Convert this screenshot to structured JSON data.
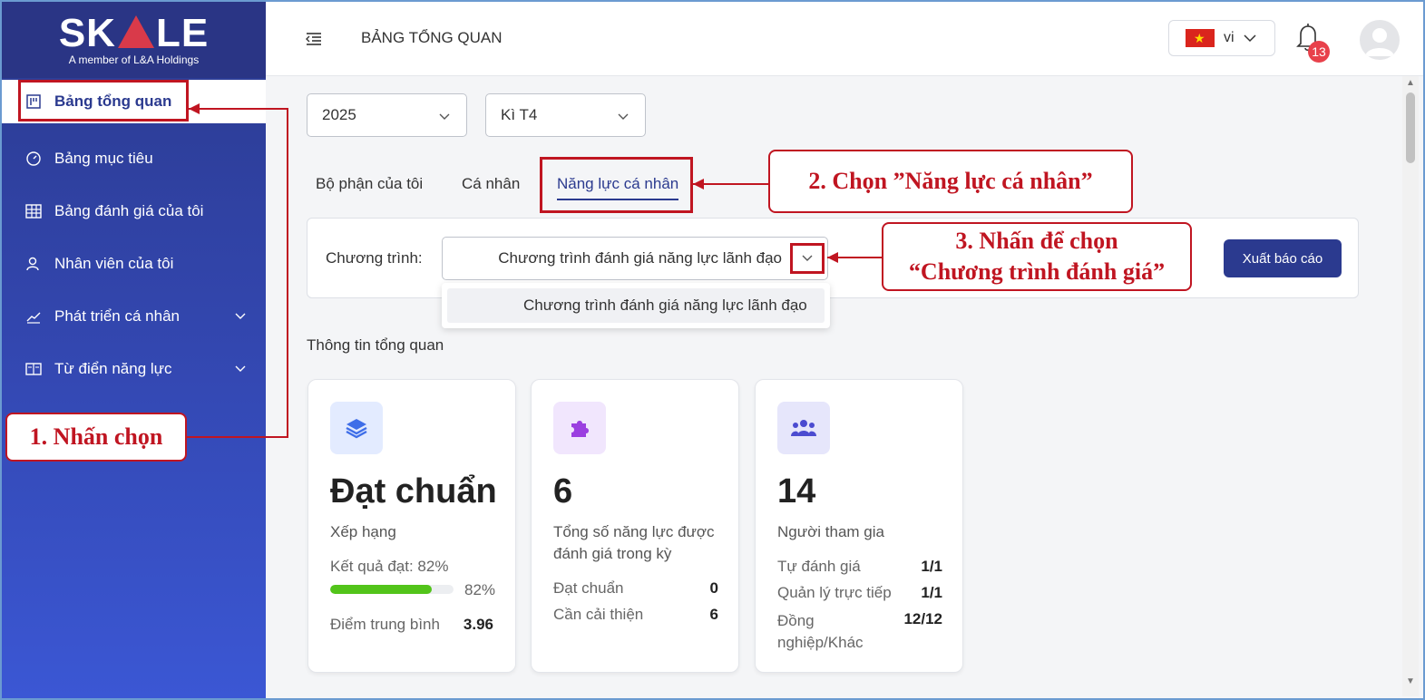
{
  "brand": {
    "logo_text": "SK LE",
    "logo_sub": "A member of L&A Holdings"
  },
  "sidebar": {
    "items": [
      {
        "label": "Bảng tổng quan",
        "icon": "dashboard-icon",
        "active": true
      },
      {
        "label": "Bảng mục tiêu",
        "icon": "gauge-icon"
      },
      {
        "label": "Bảng đánh giá của tôi",
        "icon": "table-icon"
      },
      {
        "label": "Nhân viên của tôi",
        "icon": "users-icon"
      },
      {
        "label": "Phát triển cá nhân",
        "icon": "chart-line-icon",
        "expandable": true
      },
      {
        "label": "Từ điển năng lực",
        "icon": "book-icon",
        "expandable": true
      }
    ]
  },
  "header": {
    "title": "BẢNG TỔNG QUAN",
    "language": "vi",
    "notification_count": "13"
  },
  "filters": {
    "year": "2025",
    "period": "Kì T4"
  },
  "tabs": [
    {
      "label": "Bộ phận của tôi"
    },
    {
      "label": "Cá nhân"
    },
    {
      "label": "Năng lực cá nhân",
      "active": true
    }
  ],
  "program": {
    "label": "Chương trình:",
    "selected": "Chương trình đánh giá năng lực lãnh đạo",
    "options": [
      "Chương trình đánh giá năng lực lãnh đạo"
    ],
    "export_label": "Xuất báo cáo"
  },
  "overview": {
    "title": "Thông tin tổng quan",
    "cards": [
      {
        "value": "Đạt chuẩn",
        "subtitle": "Xếp hạng",
        "result_label": "Kết quả đạt: 82%",
        "progress": 0.82,
        "progress_label": "82%",
        "avg_label": "Điểm trung bình",
        "avg_value": "3.96"
      },
      {
        "value": "6",
        "subtitle": "Tổng số năng lực được đánh giá trong kỳ",
        "rows": [
          {
            "label": "Đạt chuẩn",
            "value": "0"
          },
          {
            "label": "Cần cải thiện",
            "value": "6"
          }
        ]
      },
      {
        "value": "14",
        "subtitle": "Người tham gia",
        "rows": [
          {
            "label": "Tự đánh giá",
            "value": "1/1"
          },
          {
            "label": "Quản lý trực tiếp",
            "value": "1/1"
          },
          {
            "label": "Đồng nghiệp/Khác",
            "value": "12/12"
          }
        ]
      }
    ]
  },
  "annotations": {
    "step1": "1. Nhấn chọn",
    "step2": "2. Chọn ”Năng lực cá nhân”",
    "step3_line1": "3. Nhấn để chọn",
    "step3_line2": "“Chương trình đánh giá”",
    "color": "#c01521"
  },
  "colors": {
    "primary": "#2b3a8f",
    "progress": "#52c41a",
    "badge": "#e8414b"
  }
}
